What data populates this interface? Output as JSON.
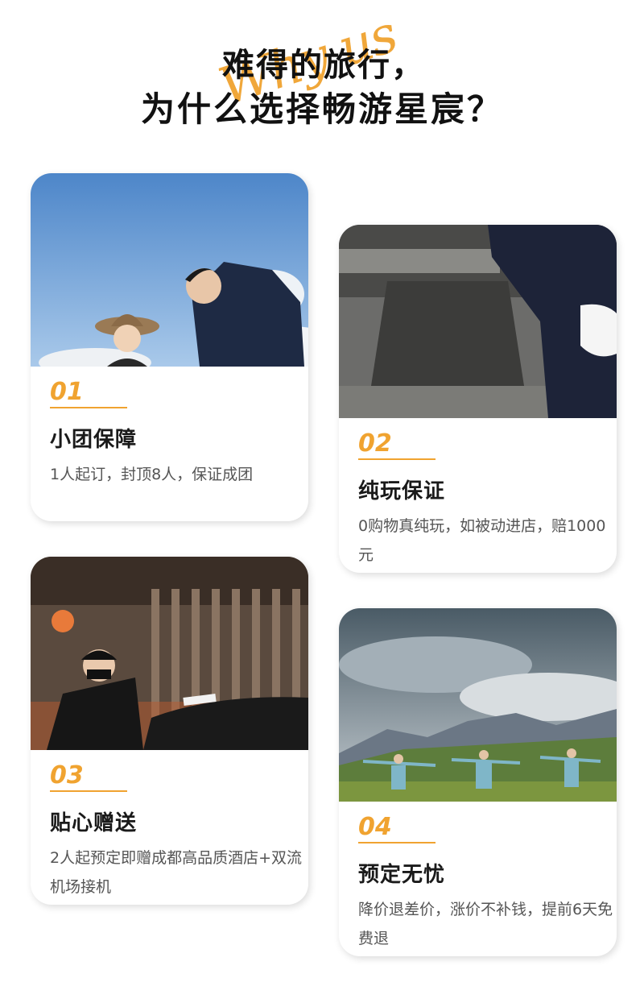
{
  "header": {
    "line1": "难得的旅行，",
    "line2": "为什么选择畅游星宸？",
    "script_text": "Why us"
  },
  "cards": [
    {
      "num": "01",
      "title": "小团保障",
      "desc": "1人起订，封顶8人，保证成团",
      "photo_icon": "couple-sky-photo"
    },
    {
      "num": "02",
      "title": "纯玩保证",
      "desc": "0购物真纯玩，如被动进店，赔1000元",
      "photo_icon": "suit-gloves-photo"
    },
    {
      "num": "03",
      "title": "贴心赠送",
      "desc": "2人起预定即赠成都高品质酒店+双流机场接机",
      "photo_icon": "chauffeur-car-photo"
    },
    {
      "num": "04",
      "title": "预定无忧",
      "desc": "降价退差价，涨价不补钱，提前6天免费退",
      "photo_icon": "mountain-travelers-photo"
    }
  ],
  "colors": {
    "accent": "#f0a330",
    "title": "#1a1a1a",
    "desc": "#555555"
  }
}
